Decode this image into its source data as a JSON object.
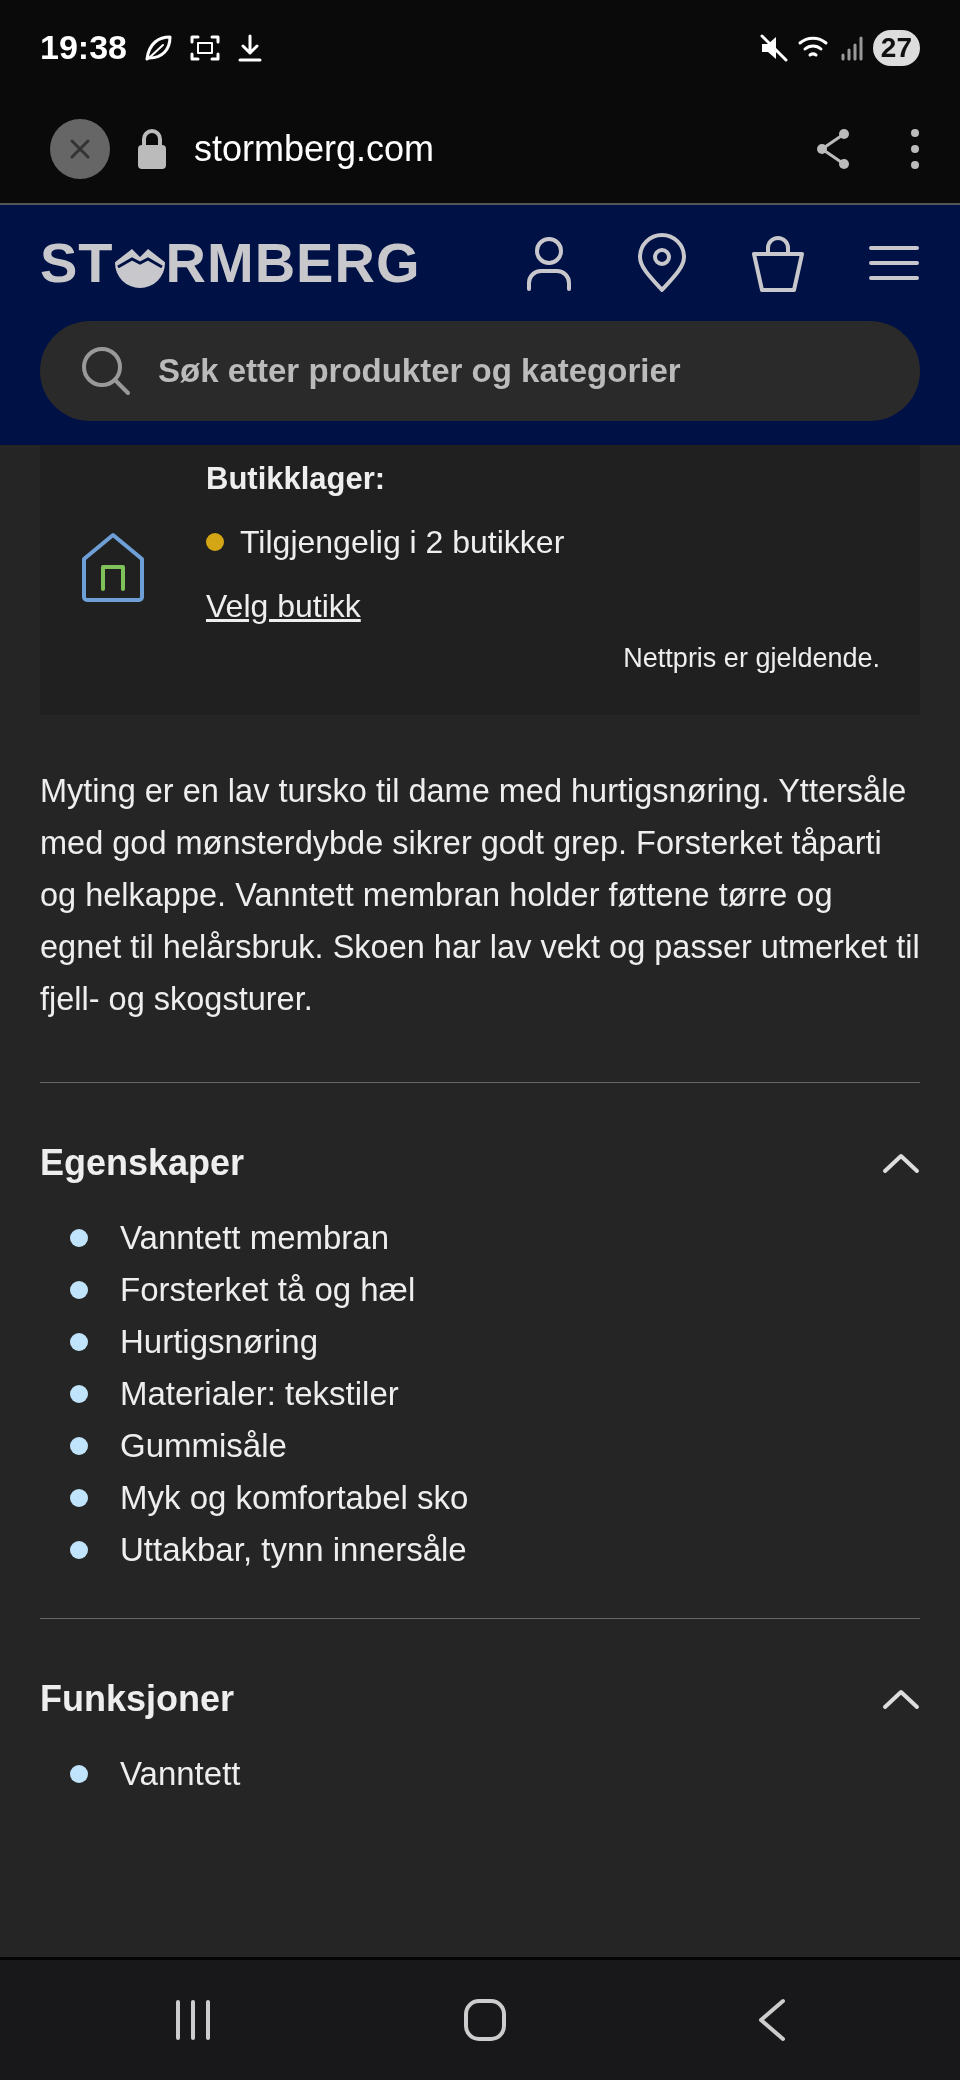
{
  "status_bar": {
    "time": "19:38",
    "battery": "27"
  },
  "browser": {
    "url": "stormberg.com"
  },
  "header": {
    "logo_start": "ST",
    "logo_end": "RMBERG",
    "search": {
      "placeholder": "Søk etter produkter og kategorier"
    }
  },
  "store_stock": {
    "title": "Butikklager:",
    "availability": {
      "text": "Tilgjengelig i 2 butikker",
      "color": "#d4a514"
    },
    "link": "Velg butikk",
    "note": "Nettpris er gjeldende."
  },
  "description": "Myting er en lav tursko til dame med hurtigsnøring. Yttersåle med god mønsterdybde sikrer godt grep. Forsterket tåparti og helkappe. Vanntett membran holder føttene tørre og egnet til helårsbruk. Skoen har lav vekt og passer utmerket til fjell- og skogsturer.",
  "sections": [
    {
      "title": "Egenskaper",
      "expanded": true,
      "items": [
        "Vanntett membran",
        "Forsterket tå og hæl",
        "Hurtigsnøring",
        "Materialer: tekstiler",
        "Gummisåle",
        "Myk og komfortabel sko",
        "Uttakbar, tynn innersåle"
      ]
    },
    {
      "title": "Funksjoner",
      "expanded": true,
      "items": [
        "Vanntett"
      ]
    }
  ]
}
